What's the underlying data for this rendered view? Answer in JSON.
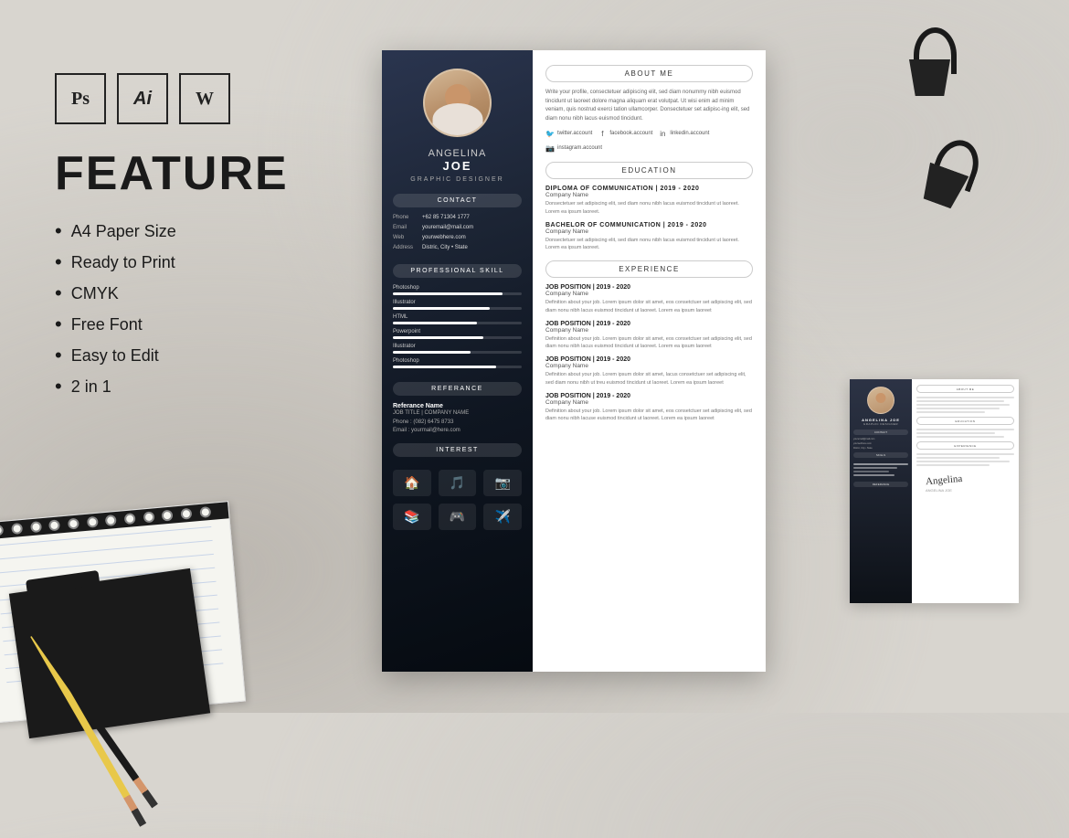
{
  "software": {
    "ps_label": "Ps",
    "ai_label": "Ai",
    "wd_label": "W"
  },
  "feature": {
    "title": "FEATURE",
    "items": [
      "A4 Paper Size",
      "Ready to Print",
      "CMYK",
      "Free Font",
      "Easy to Edit",
      "2 in 1"
    ]
  },
  "cv": {
    "name_first": "ANGELINA",
    "name_last": "JOE",
    "job_title": "GRAPHIC DESIGNER",
    "contact_label": "CONTACT",
    "contact": {
      "phone_label": "Phone",
      "phone_value": "+62 85 71304 1777",
      "email_label": "Email",
      "email_value": "youremail@mail.com",
      "web_label": "Web",
      "web_value": "yourwebhere.com",
      "address_label": "Address",
      "address_value": "Distric, City • State"
    },
    "skills_label": "PROFESSIONAL SKILL",
    "skills": [
      {
        "name": "Photoshop",
        "level": 85
      },
      {
        "name": "Illustrator",
        "level": 75
      },
      {
        "name": "HTML",
        "level": 65
      },
      {
        "name": "Powerpoint",
        "level": 70
      },
      {
        "name": "Illustrator",
        "level": 60
      },
      {
        "name": "Photoshop",
        "level": 80
      }
    ],
    "referance_label": "REFERANCE",
    "referance": {
      "name": "Referance Name",
      "job": "JOB TITLE | COMPANY NAME",
      "phone_label": "Phone",
      "phone_value": ": (082) 6475 8733",
      "email_label": "Email",
      "email_value": ": yourmail@here.com"
    },
    "interest_label": "INTEREST",
    "about_label": "ABOUT ME",
    "about_text": "Write your profile, consectetuer adipiscing elit, sed diam nonummy nibh euismod tincidunt ut laoreet dolore magna aliquam erat volutpat. Ut wisi enim ad minim veniam, quis nostrud exerci tation ullamcorper. Donsectetuer set adipisc-ing elit, sed diam nonu nibh lacus euismod tincidunt.",
    "social": [
      {
        "icon": "🐦",
        "label": "twitter.account"
      },
      {
        "icon": "f",
        "label": "facebook.account"
      },
      {
        "icon": "in",
        "label": "linkedin.account"
      },
      {
        "icon": "📷",
        "label": "instagram.account"
      }
    ],
    "education_label": "EDUCATION",
    "education": [
      {
        "degree": "DIPLOMA OF COMMUNICATION | 2019 - 2020",
        "company": "Company Name",
        "desc": "Donsectetuer set adipiscing elit, sed diam nonu nibh lacus euismod tincidunt ut laoreet. Lorem ea ipsum laoreet."
      },
      {
        "degree": "BACHELOR OF COMMUNICATION | 2019 - 2020",
        "company": "Company Name",
        "desc": "Donsectetuer set adipiscing elit, sed diam nonu nibh lacus euismod tincidunt ut laoreet. Lorem ea ipsum laoreet."
      }
    ],
    "experience_label": "EXPERIENCE",
    "experience": [
      {
        "title": "JOB POSITION | 2019 - 2020",
        "company": "Company Name",
        "desc": "Definition about your job. Lorem ipsum dolor sit amet, eos consetctuer set adipiscing elit, sed diam nonu nibh lacus euismod tincidunt ut laoreet. Lorem ea ipsum laoreet"
      },
      {
        "title": "JOB POSITION | 2019 - 2020",
        "company": "Company Name",
        "desc": "Definition about your job. Lorem ipsum dolor sit amet, eos consetctuer set adipiscing elit, sed diam nonu nibh lacus euismod tincidunt ut laoreet. Lorem ea ipsum laoreet"
      },
      {
        "title": "JOB POSITION | 2019 - 2020",
        "company": "Company Name",
        "desc": "Definition about your job. Lorem ipsum dolor sit amet, lacus consetctuer set adipiscing elit, sed diam nonu nibh ut treu euismod tincidunt ut laoreet. Lorem ea ipsum laoreet"
      },
      {
        "title": "JOB POSITION | 2019 - 2020",
        "company": "Company Name",
        "desc": "Definition about your job. Lorem ipsum dolor sit amet, eos consetctuer set adipiscing elit, sed diam nonu nibh lacuse euismod tincidunt ut laoreet. Lorem ea ipsum laoreet"
      }
    ]
  }
}
